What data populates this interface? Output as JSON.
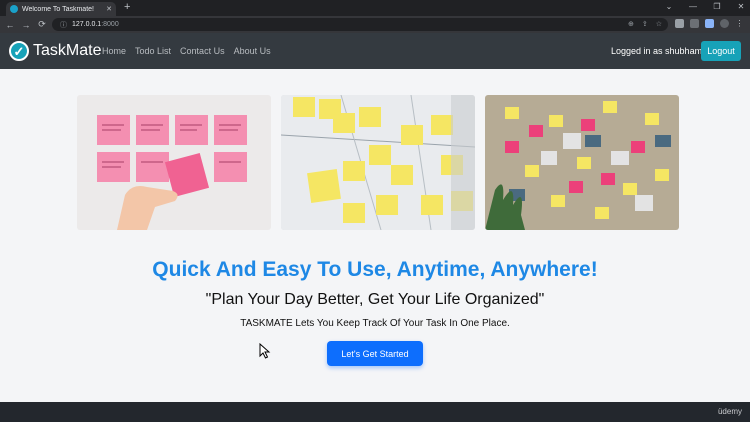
{
  "browser": {
    "tab_title": "Welcome To Taskmate!",
    "new_tab_symbol": "+",
    "window_controls": [
      "⌄",
      "—",
      "❐",
      "✕"
    ],
    "url_host": "127.0.0.1",
    "url_port": ":8000",
    "nav_icons": [
      "back-icon",
      "forward-icon",
      "reload-icon"
    ]
  },
  "navbar": {
    "brand": "TaskMate",
    "links": [
      "Home",
      "Todo List",
      "Contact Us",
      "About Us"
    ],
    "logged_in_text": "Logged in as shubham",
    "logout_label": "Logout"
  },
  "hero": {
    "headline": "Quick And Easy To Use, Anytime, Anywhere!",
    "quote": "\"Plan Your Day Better, Get Your Life Organized\"",
    "tagline": "TASKMATE Lets You Keep Track Of Your Task In One Place.",
    "cta_label": "Let's Get Started"
  },
  "watermark": "üdemy",
  "colors": {
    "navbar_bg": "#343a40",
    "accent_teal": "#17a2b8",
    "headline_blue": "#1e88e5",
    "cta_blue": "#0d6efd"
  }
}
